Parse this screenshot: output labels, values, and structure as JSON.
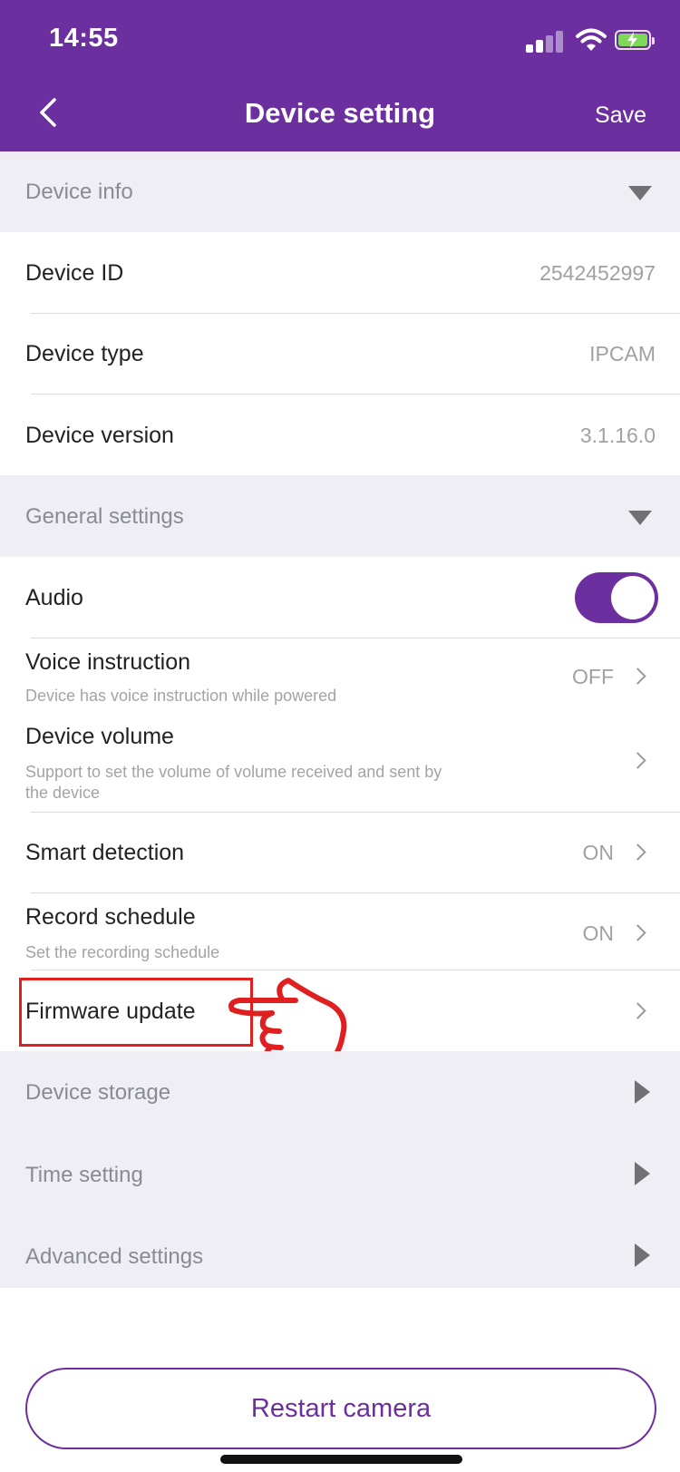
{
  "status_bar": {
    "time": "14:55"
  },
  "nav": {
    "title": "Device setting",
    "save_label": "Save"
  },
  "device_info": {
    "title": "Device info",
    "items": [
      {
        "label": "Device ID",
        "value": "2542452997"
      },
      {
        "label": "Device type",
        "value": "IPCAM"
      },
      {
        "label": "Device version",
        "value": "3.1.16.0"
      }
    ]
  },
  "general_settings": {
    "title": "General settings",
    "audio": {
      "label": "Audio",
      "enabled": true
    },
    "voice_instruction": {
      "label": "Voice instruction",
      "sub": "Device has voice instruction while powered",
      "value": "OFF"
    },
    "device_volume": {
      "label": "Device volume",
      "sub_line1": "Support to set the volume of volume received and sent by",
      "sub_line2": "the device"
    },
    "smart_detection": {
      "label": "Smart detection",
      "value": "ON"
    },
    "record_schedule": {
      "label": "Record schedule",
      "sub": "Set the recording schedule",
      "value": "ON"
    },
    "firmware_update": {
      "label": "Firmware update"
    }
  },
  "collapsed_sections": [
    {
      "label": "Device storage"
    },
    {
      "label": "Time setting"
    },
    {
      "label": "Advanced settings"
    }
  ],
  "restart_label": "Restart camera",
  "colors": {
    "accent": "#6b2f9f",
    "annotation": "#e02020"
  }
}
